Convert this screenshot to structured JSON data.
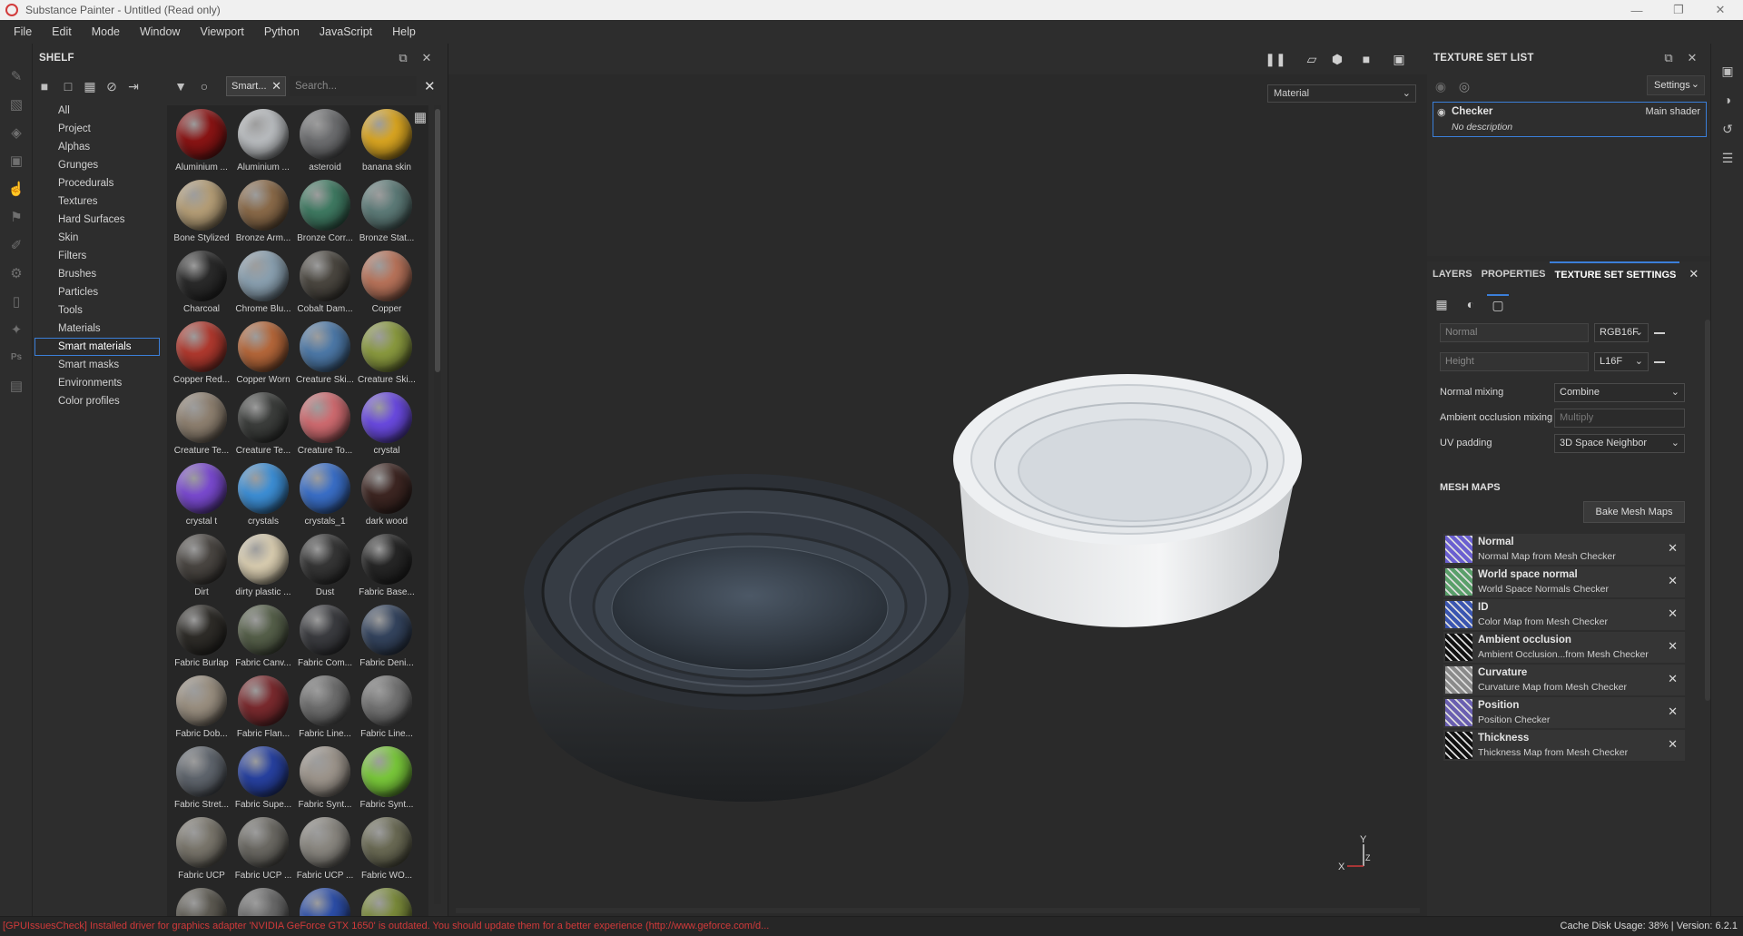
{
  "window": {
    "title": "Substance Painter - Untitled (Read only)"
  },
  "menu": [
    "File",
    "Edit",
    "Mode",
    "Window",
    "Viewport",
    "Python",
    "JavaScript",
    "Help"
  ],
  "shelf": {
    "title": "SHELF",
    "chip": "Smart...",
    "search_placeholder": "Search...",
    "categories": [
      "All",
      "Project",
      "Alphas",
      "Grunges",
      "Procedurals",
      "Textures",
      "Hard Surfaces",
      "Skin",
      "Filters",
      "Brushes",
      "Particles",
      "Tools",
      "Materials",
      "Smart materials",
      "Smart masks",
      "Environments",
      "Color profiles"
    ],
    "active_category": "Smart materials",
    "materials": [
      {
        "label": "Aluminium ...",
        "color": "#8a1414"
      },
      {
        "label": "Aluminium ...",
        "color": "#b9bcbf"
      },
      {
        "label": "asteroid",
        "color": "#6d6e70"
      },
      {
        "label": "banana skin",
        "color": "#d9a521"
      },
      {
        "label": "Bone Stylized",
        "color": "#b59e77"
      },
      {
        "label": "Bronze Arm...",
        "color": "#8a6a49"
      },
      {
        "label": "Bronze Corr...",
        "color": "#3f7a62"
      },
      {
        "label": "Bronze Stat...",
        "color": "#5d7b78"
      },
      {
        "label": "Charcoal",
        "color": "#2a2a2a"
      },
      {
        "label": "Chrome Blu...",
        "color": "#8aa0b0"
      },
      {
        "label": "Cobalt Dam...",
        "color": "#4b4740"
      },
      {
        "label": "Copper",
        "color": "#b8735a"
      },
      {
        "label": "Copper Red...",
        "color": "#b0392e"
      },
      {
        "label": "Copper Worn",
        "color": "#b5673a"
      },
      {
        "label": "Creature Ski...",
        "color": "#4d79a8"
      },
      {
        "label": "Creature Ski...",
        "color": "#8a9a3f"
      },
      {
        "label": "Creature Te...",
        "color": "#8e8070"
      },
      {
        "label": "Creature Te...",
        "color": "#3c3e3c"
      },
      {
        "label": "Creature To...",
        "color": "#cf6b70"
      },
      {
        "label": "crystal",
        "color": "#6a4ae0"
      },
      {
        "label": "crystal t",
        "color": "#7a4ad0"
      },
      {
        "label": "crystals",
        "color": "#3d8fd6"
      },
      {
        "label": "crystals_1",
        "color": "#3a6fc8"
      },
      {
        "label": "dark wood",
        "color": "#3d2622"
      },
      {
        "label": "Dirt",
        "color": "#4a4642"
      },
      {
        "label": "dirty plastic ...",
        "color": "#d9cdb0"
      },
      {
        "label": "Dust",
        "color": "#363636"
      },
      {
        "label": "Fabric Base...",
        "color": "#262626"
      },
      {
        "label": "Fabric Burlap",
        "color": "#2e2c28"
      },
      {
        "label": "Fabric Canv...",
        "color": "#56604a"
      },
      {
        "label": "Fabric Com...",
        "color": "#3b3c40"
      },
      {
        "label": "Fabric Deni...",
        "color": "#34445e"
      },
      {
        "label": "Fabric Dob...",
        "color": "#9a8f80"
      },
      {
        "label": "Fabric Flan...",
        "color": "#7a2a2e"
      },
      {
        "label": "Fabric Line...",
        "color": "#6e6e6e"
      },
      {
        "label": "Fabric Line...",
        "color": "#737373"
      },
      {
        "label": "Fabric Stret...",
        "color": "#5f656d"
      },
      {
        "label": "Fabric Supe...",
        "color": "#2741a0"
      },
      {
        "label": "Fabric Synt...",
        "color": "#9d958c"
      },
      {
        "label": "Fabric Synt...",
        "color": "#79c83a"
      },
      {
        "label": "Fabric UCP",
        "color": "#7a766c"
      },
      {
        "label": "Fabric UCP ...",
        "color": "#6b6963"
      },
      {
        "label": "Fabric UCP ...",
        "color": "#8a8780"
      },
      {
        "label": "Fabric WO...",
        "color": "#6a6a54"
      },
      {
        "label": "",
        "color": "#5d5a52"
      },
      {
        "label": "",
        "color": "#6a6a6a"
      },
      {
        "label": "",
        "color": "#2c4ea8"
      },
      {
        "label": "",
        "color": "#7a8a3a"
      }
    ]
  },
  "viewport": {
    "mode": "Material"
  },
  "texture_set_list": {
    "title": "TEXTURE SET LIST",
    "settings_label": "Settings",
    "item_name": "Checker",
    "item_shader": "Main shader",
    "item_desc": "No description"
  },
  "properties": {
    "tabs": [
      "LAYERS",
      "PROPERTIES",
      "TEXTURE SET SETTINGS"
    ],
    "active_tab": "TEXTURE SET SETTINGS",
    "normal_channel": "Normal",
    "normal_format": "RGB16F",
    "height_channel": "Height",
    "height_format": "L16F",
    "normal_mixing_label": "Normal mixing",
    "normal_mixing_value": "Combine",
    "ao_mixing_label": "Ambient occlusion mixing",
    "ao_mixing_value": "Multiply",
    "uv_padding_label": "UV padding",
    "uv_padding_value": "3D Space Neighbor",
    "mesh_maps_title": "MESH MAPS",
    "bake_label": "Bake Mesh Maps",
    "mesh_maps": [
      {
        "name": "Normal",
        "source": "Normal Map from Mesh Checker",
        "color": "#6a5fd0"
      },
      {
        "name": "World space normal",
        "source": "World Space Normals Checker",
        "color": "#5a9f6a"
      },
      {
        "name": "ID",
        "source": "Color Map from Mesh Checker",
        "color": "#3a55b0"
      },
      {
        "name": "Ambient occlusion",
        "source": "Ambient Occlusion...from Mesh Checker",
        "color": "#111111"
      },
      {
        "name": "Curvature",
        "source": "Curvature Map from Mesh Checker",
        "color": "#8a8a8a"
      },
      {
        "name": "Position",
        "source": "Position Checker",
        "color": "#6a5fb0"
      },
      {
        "name": "Thickness",
        "source": "Thickness Map from Mesh Checker",
        "color": "#111111"
      }
    ]
  },
  "status": {
    "message": "[GPUIssuesCheck] Installed driver for graphics adapter 'NVIDIA GeForce GTX 1650' is outdated. You should update them for a better experience (http://www.geforce.com/d...",
    "cache": "Cache Disk Usage:    38% | Version: 6.2.1"
  },
  "colors": {
    "accent": "#3b7fd9",
    "error": "#d13a3a"
  }
}
